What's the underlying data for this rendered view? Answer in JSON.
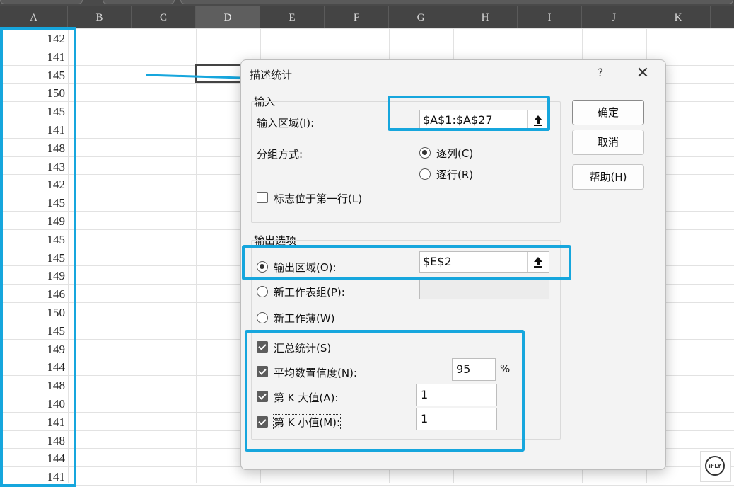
{
  "spreadsheet": {
    "columns": [
      "A",
      "B",
      "C",
      "D",
      "E",
      "F",
      "G",
      "H",
      "I",
      "J",
      "K"
    ],
    "column_a_values": [
      "142",
      "141",
      "145",
      "150",
      "145",
      "141",
      "148",
      "143",
      "142",
      "145",
      "149",
      "145",
      "145",
      "149",
      "146",
      "150",
      "145",
      "149",
      "144",
      "148",
      "140",
      "141",
      "148",
      "144",
      "141"
    ]
  },
  "dialog": {
    "title": "描述统计",
    "help": "?",
    "close": "✕",
    "input_group_label": "输入",
    "input_range_label": "输入区域(I):",
    "input_range_value": "$A$1:$A$27",
    "grouping_label": "分组方式:",
    "group_by_column": "逐列(C)",
    "group_by_row": "逐行(R)",
    "labels_first_row": "标志位于第一行(L)",
    "output_group_label": "输出选项",
    "output_range_label": "输出区域(O):",
    "output_range_value": "$E$2",
    "new_worksheet_label": "新工作表组(P):",
    "new_workbook_label": "新工作薄(W)",
    "summary_stats_label": "汇总统计(S)",
    "confidence_label": "平均数置信度(N):",
    "confidence_value": "95",
    "percent_sign": "%",
    "kth_largest_label": "第 K 大值(A):",
    "kth_largest_value": "1",
    "kth_smallest_label": "第 K 小值(M):",
    "kth_smallest_value": "1",
    "ok_button": "确定",
    "cancel_button": "取消",
    "help_button": "帮助(H)"
  },
  "colors": {
    "highlight": "#16a6dd",
    "header_bg": "#444444"
  },
  "logo_text": "iFLY"
}
